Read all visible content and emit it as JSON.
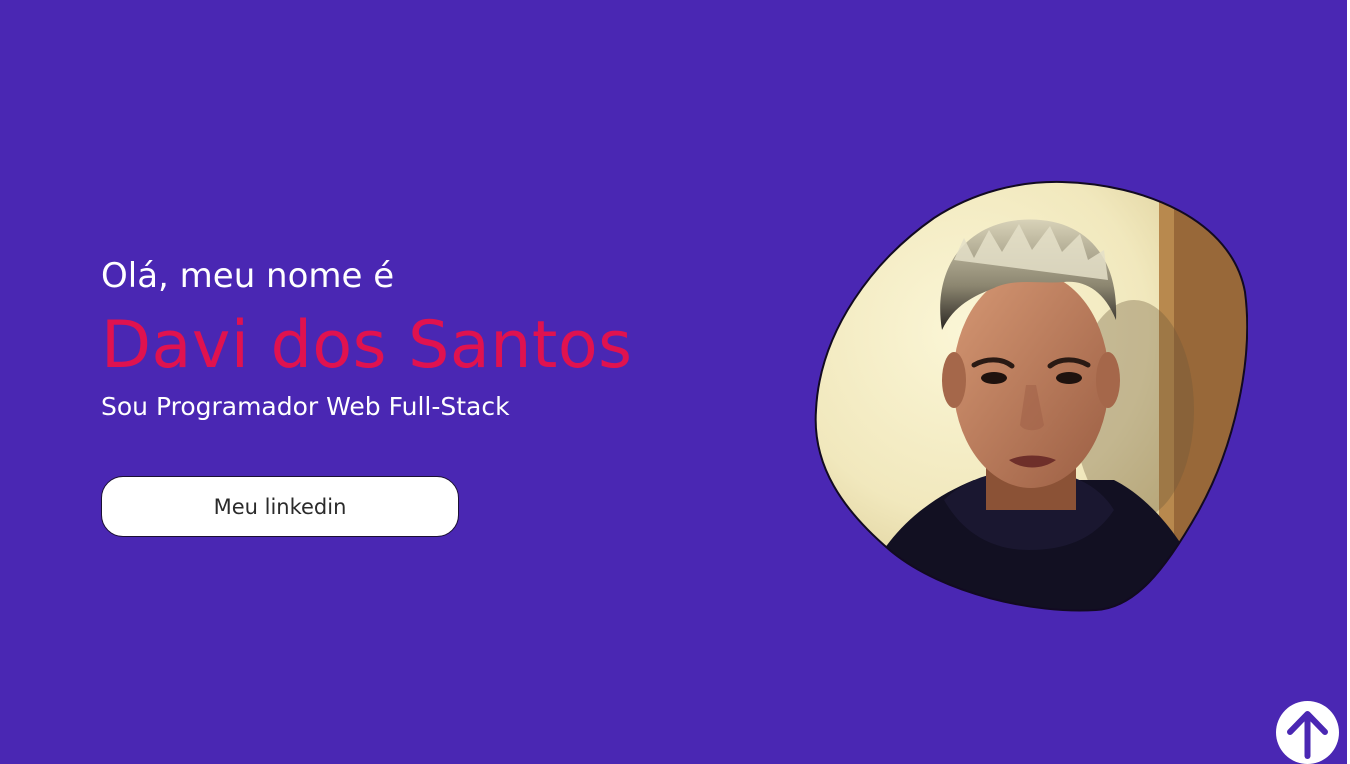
{
  "hero": {
    "greeting": "Olá, meu nome é",
    "name": "Davi dos Santos",
    "role": "Sou Programador Web Full-Stack",
    "linkedin_label": "Meu linkedin"
  },
  "profile_photo": {
    "alt": "Davi dos Santos"
  },
  "icons": {
    "scroll_top": "arrow-up-circle-icon"
  },
  "colors": {
    "background": "#4a27b3",
    "name_accent": "#e0124f",
    "text": "#ffffff",
    "button_background": "#ffffff"
  }
}
